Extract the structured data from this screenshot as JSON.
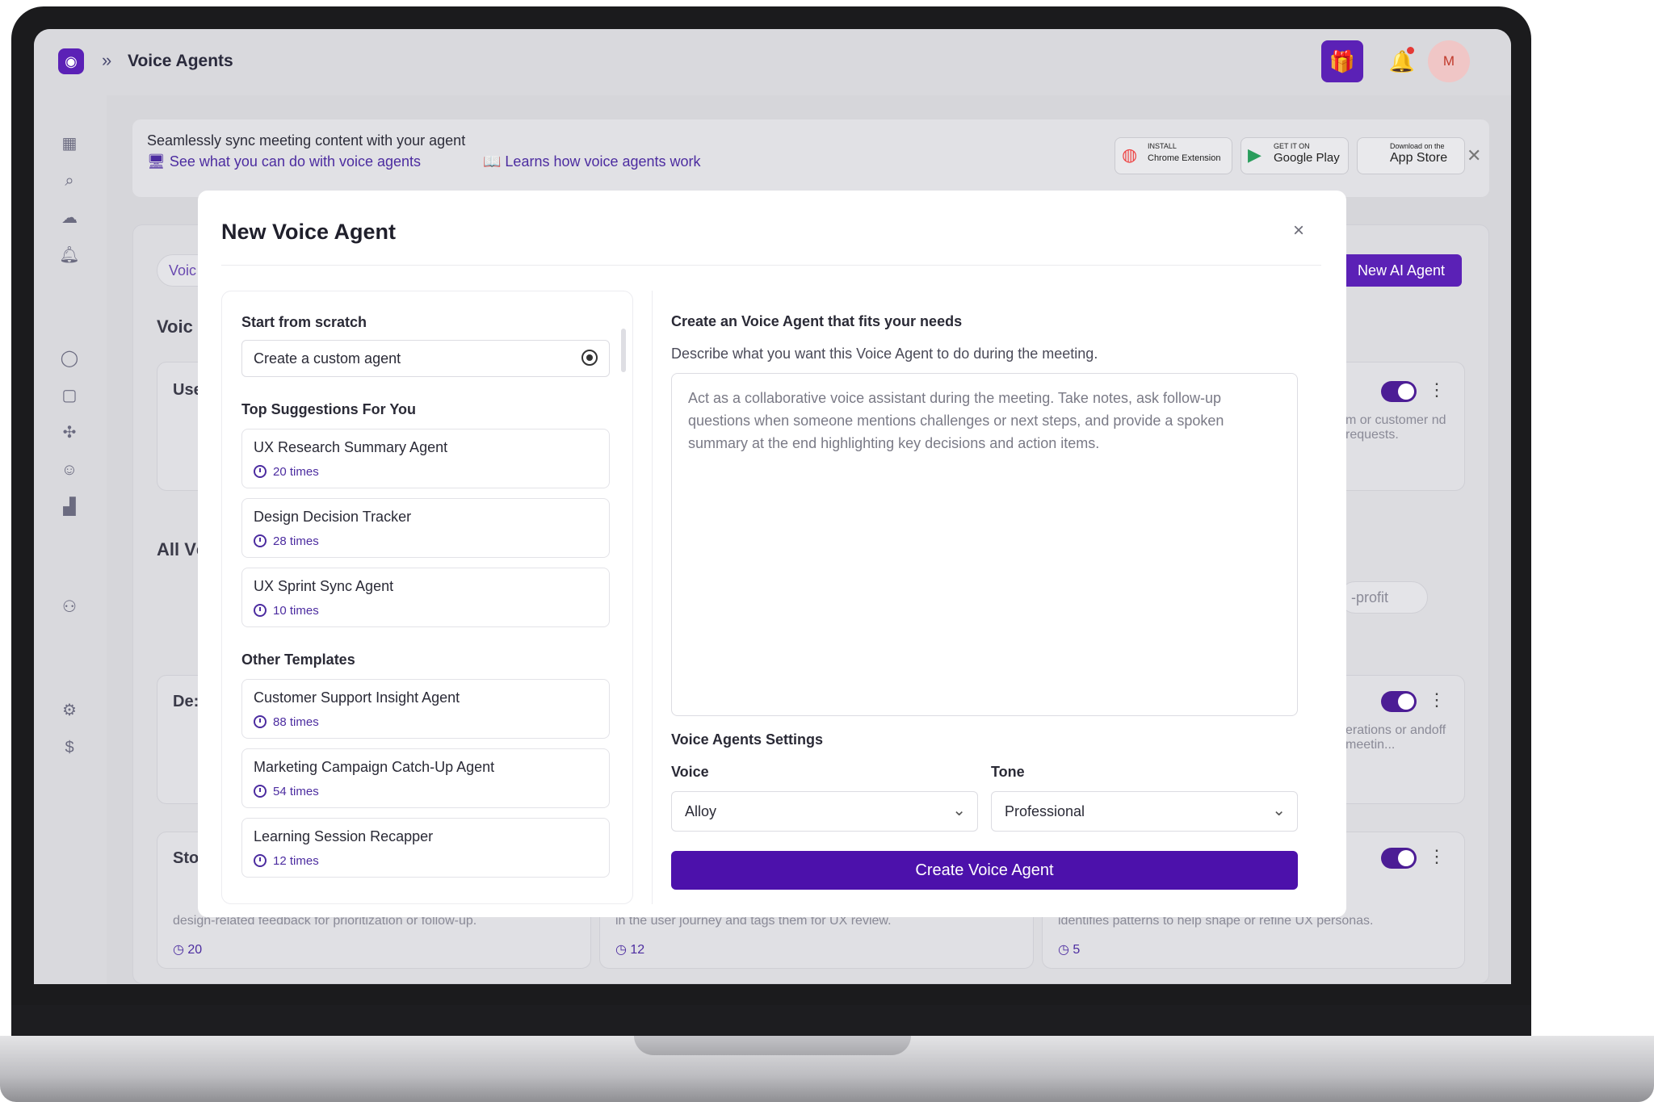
{
  "app": {
    "breadcrumb_sep": "»",
    "page_title": "Voice Agents",
    "avatar_initial": "M"
  },
  "banner": {
    "title": "Seamlessly sync meeting content with your agent",
    "link1": "See what you can do with voice agents",
    "link2": "Learns how voice agents work",
    "chrome": "Chrome Extension",
    "chrome_small": "INSTALL",
    "google_play": "Google Play",
    "google_small": "GET IT ON",
    "app_store": "App Store",
    "app_store_small": "Download on the"
  },
  "background": {
    "new_agent_button": "New AI Agent",
    "tab_partial": "Voic",
    "section1_partial": "Voic",
    "section2_partial": "All Vc",
    "card1_title": "Use",
    "card1_text_right": "m or customer nd requests.",
    "card2_title": "De:",
    "card2_text_right": "erations or andoff meetin...",
    "card3_title": "Sto",
    "card3_text": "design-related feedback for prioritization or follow-up.",
    "card4_text": "in the user journey and tags them for UX review.",
    "card5_text": "identifies patterns to help shape or refine UX personas.",
    "card3_count": "20",
    "card4_count": "12",
    "card5_count": "5",
    "chip_profit": "-profit"
  },
  "modal": {
    "title": "New Voice Agent",
    "close": "×",
    "scratch_heading": "Start from scratch",
    "custom_agent": "Create a custom agent",
    "suggestions_heading": "Top Suggestions For You",
    "suggestions": [
      {
        "name": "UX Research Summary Agent",
        "uses": "20 times"
      },
      {
        "name": "Design Decision Tracker",
        "uses": "28 times"
      },
      {
        "name": "UX Sprint Sync Agent",
        "uses": "10 times"
      }
    ],
    "other_heading": "Other Templates",
    "others": [
      {
        "name": "Customer Support Insight Agent",
        "uses": "88 times"
      },
      {
        "name": "Marketing Campaign Catch-Up Agent",
        "uses": "54 times"
      },
      {
        "name": "Learning Session Recapper",
        "uses": "12 times"
      }
    ],
    "right_heading": "Create an Voice Agent that fits your needs",
    "right_desc": "Describe what you want this Voice Agent to do during the meeting.",
    "prompt_placeholder": "Act as a collaborative voice assistant during the meeting. Take notes, ask follow-up questions when someone mentions challenges or next steps, and provide a spoken summary at the end highlighting key decisions and action items.",
    "settings_heading": "Voice Agents Settings",
    "voice_label": "Voice",
    "voice_value": "Alloy",
    "tone_label": "Tone",
    "tone_value": "Professional",
    "create_button": "Create Voice Agent"
  },
  "colors": {
    "accent": "#5b21b6",
    "primary_button": "#4c11ab"
  }
}
